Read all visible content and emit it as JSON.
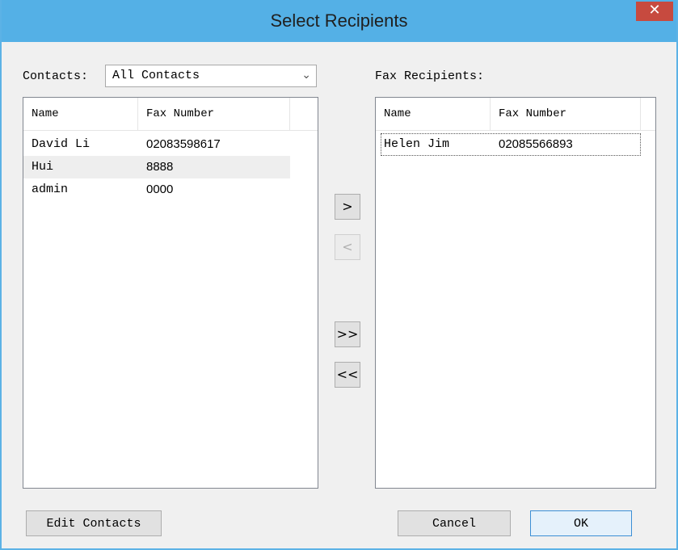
{
  "window": {
    "title": "Select Recipients",
    "close_glyph": "✕"
  },
  "contacts": {
    "label": "Contacts:",
    "filter_value": "All Contacts",
    "columns": [
      "Name",
      "Fax Number"
    ],
    "rows": [
      {
        "name": "David Li",
        "fax": "02083598617"
      },
      {
        "name": "Hui",
        "fax": "8888"
      },
      {
        "name": "admin",
        "fax": "0000"
      }
    ]
  },
  "recipients": {
    "label": "Fax Recipients:",
    "columns": [
      "Name",
      "Fax Number"
    ],
    "rows": [
      {
        "name": "Helen Jim",
        "fax": "02085566893"
      }
    ]
  },
  "transfer_buttons": {
    "add": ">",
    "remove": "<",
    "add_all": ">>",
    "remove_all": "<<"
  },
  "footer": {
    "edit_contacts": "Edit Contacts",
    "cancel": "Cancel",
    "ok": "OK"
  },
  "colors": {
    "titlebar": "#54b0e6",
    "close": "#c74a3f",
    "dialog_bg": "#f0f0f0"
  }
}
